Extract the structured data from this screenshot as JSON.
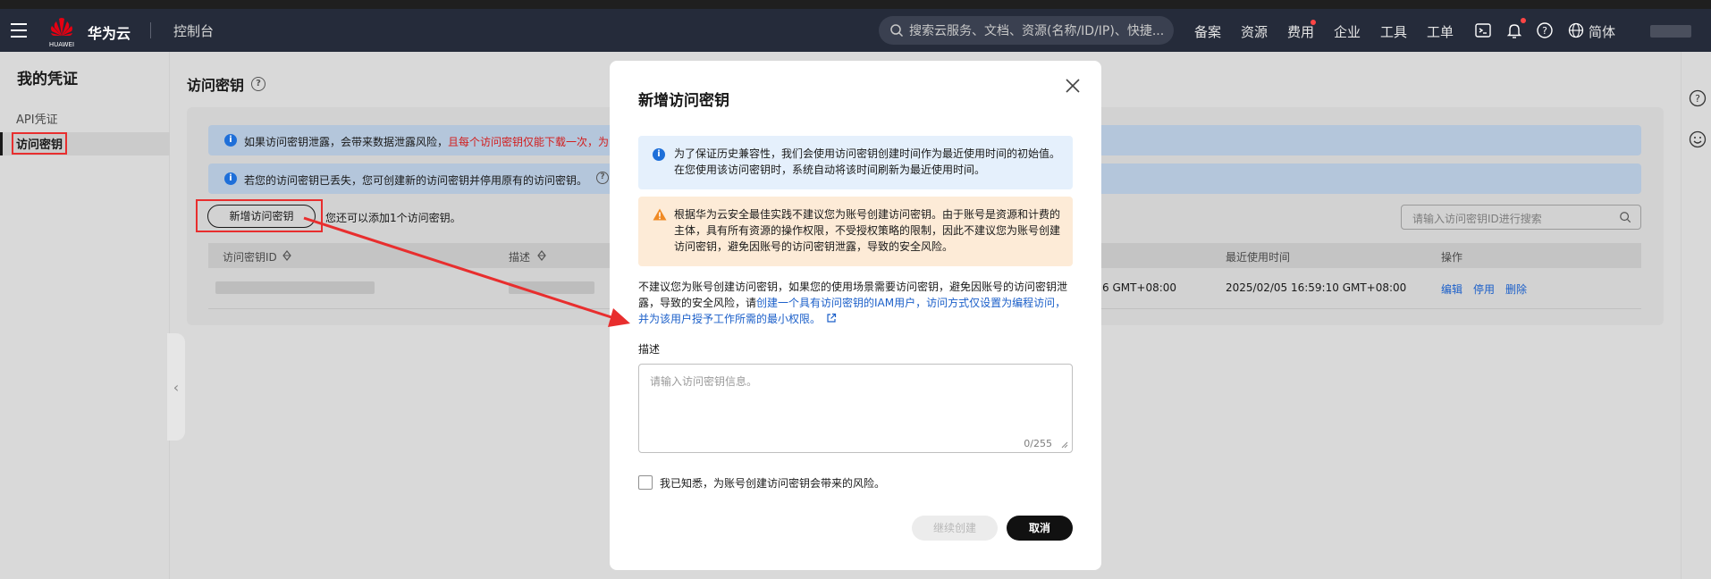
{
  "header": {
    "brand": "华为云",
    "logo_text": "HUAWEI",
    "console": "控制台",
    "search_placeholder": "搜索云服务、文档、资源(名称/ID/IP)、快捷...",
    "nav": [
      "备案",
      "资源",
      "费用",
      "企业",
      "工具",
      "工单"
    ],
    "language": "简体"
  },
  "sidebar": {
    "title": "我的凭证",
    "items": [
      {
        "label": "API凭证"
      },
      {
        "label": "访问密钥"
      }
    ]
  },
  "main": {
    "title": "访问密钥",
    "alert1_text": "如果访问密钥泄露，会带来数据泄露风险，",
    "alert1_red": "且每个访问密钥仅能下载一次，为",
    "alert2_text": "若您的访问密钥已丢失，您可创建新的访问密钥并停用原有的访问密钥。",
    "add_button": "新增访问密钥",
    "hint": "您还可以添加1个访问密钥。",
    "search_placeholder": "请输入访问密钥ID进行搜索",
    "columns": {
      "id": "访问密钥ID",
      "desc": "描述",
      "last_used": "最近使用时间",
      "actions": "操作"
    },
    "row": {
      "created_partial": "6 GMT+08:00",
      "last_used": "2025/02/05 16:59:10 GMT+08:00",
      "actions": [
        "编辑",
        "停用",
        "删除"
      ]
    }
  },
  "modal": {
    "title": "新增访问密钥",
    "info_text": "为了保证历史兼容性，我们会使用访问密钥创建时间作为最近使用时间的初始值。在您使用该访问密钥时，系统自动将该时间刷新为最近使用时间。",
    "warn_text": "根据华为云安全最佳实践不建议您为账号创建访问密钥。由于账号是资源和计费的主体，具有所有资源的操作权限，不受授权策略的限制，因此不建议您为账号创建访问密钥，避免因账号的访问密钥泄露，导致的安全风险。",
    "para_text": "不建议您为账号创建访问密钥，如果您的使用场景需要访问密钥，避免因账号的访问密钥泄露，导致的安全风险，请",
    "para_link": "创建一个具有访问密钥的IAM用户，访问方式仅设置为编程访问，并为该用户授予工作所需的最小权限。",
    "desc_label": "描述",
    "desc_placeholder": "请输入访问密钥信息。",
    "desc_counter": "0/255",
    "checkbox_label": "我已知悉，为账号创建访问密钥会带来的风险。",
    "continue_button": "继续创建",
    "cancel_button": "取消"
  },
  "colors": {
    "header_bg": "#252b3a",
    "link_blue": "#1b5fc9",
    "alert_red": "#d21d1d",
    "annotation_red": "#e82e2e"
  }
}
